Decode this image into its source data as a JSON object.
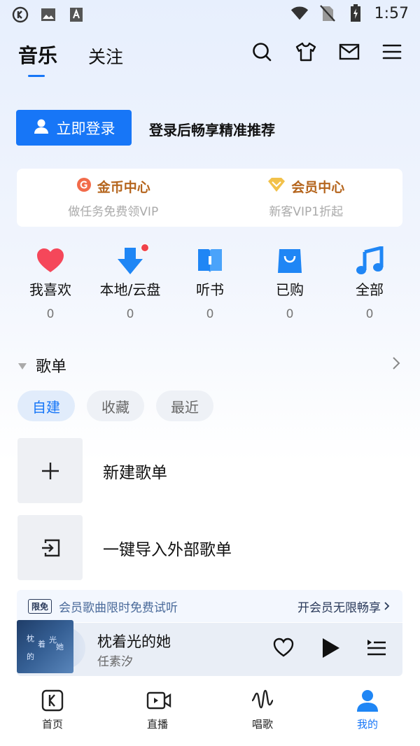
{
  "status_bar": {
    "time": "1:57",
    "icons": [
      "k-app-icon",
      "image-icon",
      "text-a-icon",
      "wifi-icon",
      "sim-off-icon",
      "battery-charging-icon"
    ]
  },
  "header": {
    "tabs": [
      {
        "label": "音乐",
        "active": true
      },
      {
        "label": "关注",
        "active": false
      }
    ],
    "icons": [
      "search-icon",
      "tshirt-icon",
      "mail-icon",
      "menu-icon"
    ]
  },
  "login": {
    "button_label": "立即登录",
    "hint": "登录后畅享精准推荐"
  },
  "coin_card": {
    "left": {
      "title": "金币中心",
      "sub": "做任务免费领VIP",
      "icon": "g-coin-icon"
    },
    "right": {
      "title": "会员中心",
      "sub": "新客VIP1折起",
      "icon": "diamond-icon"
    }
  },
  "quick_entries": [
    {
      "label": "我喜欢",
      "count": "0",
      "icon": "heart-icon"
    },
    {
      "label": "本地/云盘",
      "count": "0",
      "icon": "download-icon"
    },
    {
      "label": "听书",
      "count": "0",
      "icon": "book-icon"
    },
    {
      "label": "已购",
      "count": "0",
      "icon": "bag-icon"
    },
    {
      "label": "全部",
      "count": "0",
      "icon": "music-note-icon"
    }
  ],
  "playlist": {
    "title": "歌单",
    "chips": [
      {
        "label": "自建",
        "active": true
      },
      {
        "label": "收藏",
        "active": false
      },
      {
        "label": "最近",
        "active": false
      }
    ],
    "rows": [
      {
        "label": "新建歌单",
        "icon": "plus-icon"
      },
      {
        "label": "一键导入外部歌单",
        "icon": "import-icon"
      }
    ]
  },
  "vip_strip": {
    "badge": "限免",
    "text": "会员歌曲限时免费试听",
    "link": "开会员无限畅享"
  },
  "player": {
    "song": "枕着光的她",
    "artist": "任素汐",
    "cover_text": [
      "枕",
      "着",
      "光",
      "的",
      "她"
    ]
  },
  "nav": [
    {
      "label": "首页",
      "icon": "k-home-icon",
      "active": false
    },
    {
      "label": "直播",
      "icon": "live-video-icon",
      "active": false
    },
    {
      "label": "唱歌",
      "icon": "sing-wave-icon",
      "active": false
    },
    {
      "label": "我的",
      "icon": "user-profile-icon",
      "active": true
    }
  ],
  "colors": {
    "accent": "#1776f7",
    "heart": "#f0424a",
    "coin": "#b5651d"
  }
}
